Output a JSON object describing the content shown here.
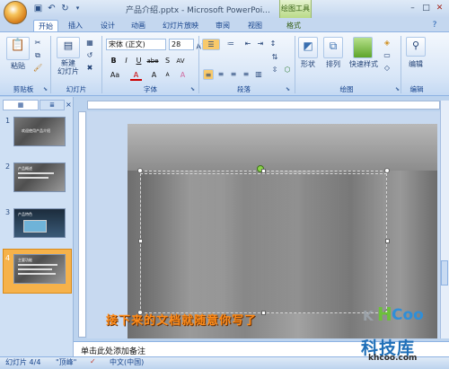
{
  "window": {
    "title": "产品介绍.pptx - Microsoft PowerPoi...",
    "contextual_tab": "绘图工具"
  },
  "qat": {
    "save_icon": "save-icon",
    "undo_icon": "undo-icon",
    "redo_icon": "redo-icon",
    "more_icon": "dropdown-icon"
  },
  "tabs": [
    "开始",
    "插入",
    "设计",
    "动画",
    "幻灯片放映",
    "审阅",
    "视图",
    "格式"
  ],
  "ribbon": {
    "clipboard": {
      "label": "剪贴板",
      "paste": "粘贴"
    },
    "slides": {
      "label": "幻灯片",
      "new_slide": "新建\n幻灯片"
    },
    "font": {
      "label": "字体",
      "name": "宋体 (正文)",
      "size": "28",
      "bold": "B",
      "italic": "I",
      "underline": "U",
      "strike": "abe",
      "shadow": "S",
      "spacing": "AV",
      "case": "Aa",
      "color": "A",
      "grow": "A",
      "shrink": "A",
      "clear": "A"
    },
    "paragraph": {
      "label": "段落"
    },
    "drawing": {
      "label": "绘图",
      "shapes": "形状",
      "arrange": "排列",
      "quick_styles": "快速样式"
    },
    "editing": {
      "label": "编辑",
      "find": "编辑"
    }
  },
  "panes": {
    "tab_slides": "",
    "tab_outline": ""
  },
  "slides": [
    {
      "num": "1",
      "title": "欢迎使用产品介绍"
    },
    {
      "num": "2",
      "title": "产品概述"
    },
    {
      "num": "3",
      "title": "产品特色"
    },
    {
      "num": "4",
      "title": "主要功能"
    }
  ],
  "slide": {
    "overlay": "接下来的文档就随意你写了"
  },
  "notes": {
    "placeholder": "单击此处添加备注"
  },
  "status": {
    "slide": "幻灯片 4/4",
    "theme": "\"顶峰\"",
    "language": "中文(中国)"
  },
  "watermark": {
    "brand": "KHCoo",
    "cn": "科技库",
    "url": "khcoo.com"
  },
  "colors": {
    "ribbon": "#dbe7f6",
    "accent_orange": "#ff8c1a",
    "watermark_green": "#6cc13a",
    "watermark_blue": "#2f8fd9"
  }
}
